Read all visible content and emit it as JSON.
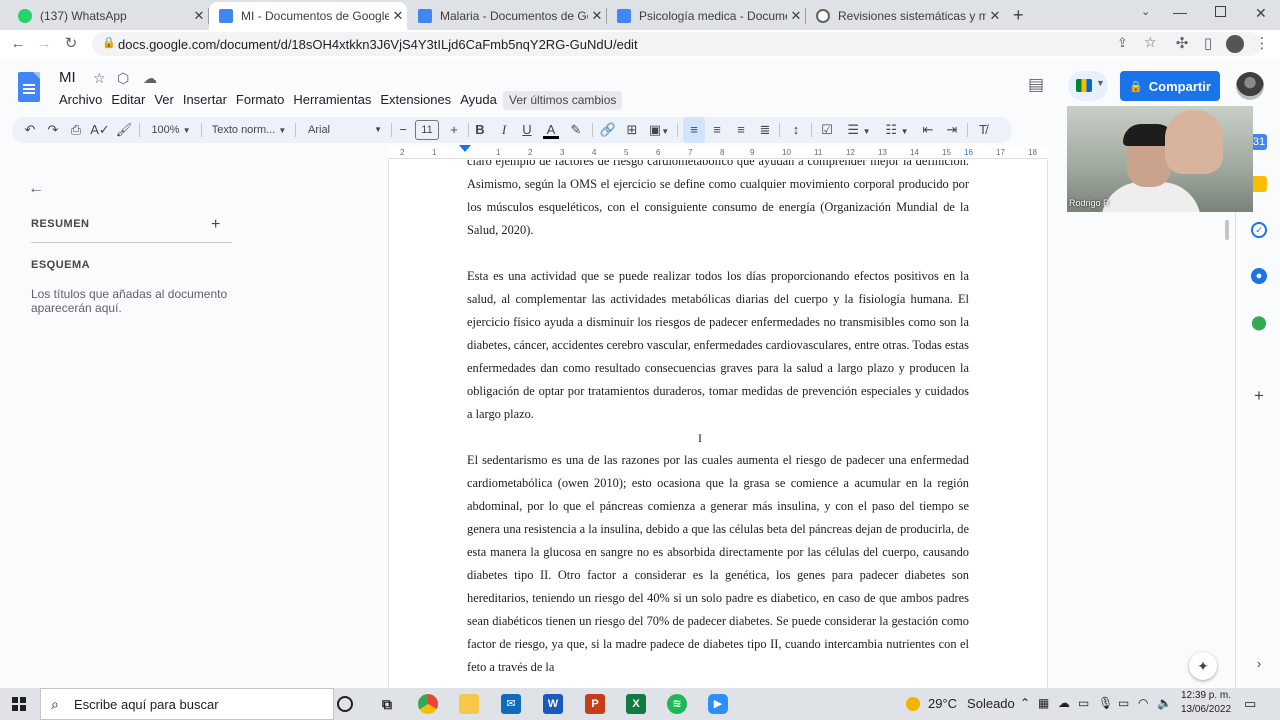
{
  "browser": {
    "tabs": [
      {
        "title": "(137) WhatsApp",
        "favicon_color": "#25d366",
        "active": false
      },
      {
        "title": "MI - Documentos de Google",
        "favicon_color": "#4285f4",
        "active": true
      },
      {
        "title": "Malaria - Documentos de Google",
        "favicon_color": "#4285f4",
        "active": false
      },
      {
        "title": "Psicología medica - Documentos de Google",
        "favicon_color": "#4285f4",
        "active": false
      },
      {
        "title": "Revisiones sistemáticas y metaanálisis",
        "favicon_color": "#5f6368",
        "active": false
      }
    ],
    "url": "docs.google.com/document/d/18sOH4xtkkn3J6VjS4Y3tILjd6CaFmb5nqY2RG-GuNdU/edit",
    "new_tab_icon": "plus-icon"
  },
  "docs": {
    "title": "MI",
    "menu": [
      "Archivo",
      "Editar",
      "Ver",
      "Insertar",
      "Formato",
      "Herramientas",
      "Extensiones",
      "Ayuda"
    ],
    "last_edit": "Ver últimos cambios",
    "share_label": "Compartir",
    "accent": "#1a73e8"
  },
  "toolbar": {
    "zoom": "100%",
    "style": "Texto norm...",
    "font": "Arial",
    "font_size": "11"
  },
  "ruler": {
    "ticks": [
      "2",
      "1",
      "1",
      "2",
      "3",
      "4",
      "5",
      "6",
      "7",
      "8",
      "9",
      "10",
      "11",
      "12",
      "13",
      "14",
      "15",
      "16",
      "17",
      "18"
    ]
  },
  "outline": {
    "summary_heading": "RESUMEN",
    "outline_heading": "ESQUEMA",
    "hint": "Los títulos que añadas al documento aparecerán aquí."
  },
  "document": {
    "paragraphs": [
      "claro ejemplo de factores de riesgo cardiometabolico que ayudan a comprender mejor la definicion. Asimismo, según la OMS el ejercicio se define como cualquier movimiento corporal producido por los músculos esqueléticos, con el consiguiente consumo de energía (Organización Mundial de la Salud, 2020).",
      "Esta es una actividad que se puede realizar todos los días proporcionando efectos positivos en la salud, al complementar las actividades metabólicas diarias del cuerpo y la fisiología humana. El ejercicio físico ayuda a disminuir los riesgos de padecer enfermedades no transmisibles como son la  diabetes, cáncer, accidentes cerebro vascular, enfermedades cardiovasculares, entre otras. Todas estas enfermedades dan como resultado consecuencias graves para la salud a largo plazo y producen la obligación de optar por tratamientos duraderos, tomar  medidas de prevención especiales y cuidados a largo plazo.",
      "El sedentarismo es una de las razones por las cuales aumenta el riesgo de padecer una enfermedad cardiometabólica (owen 2010); esto ocasiona que  la grasa se comience a acumular en la región abdominal, por lo que el páncreas comienza a generar más insulina, y con el paso del tiempo se genera una resistencia a la insulina, debido a que las células beta del páncreas dejan de producirla, de esta manera la glucosa en sangre no es absorbida directamente por las células del cuerpo, causando diabetes tipo II. Otro factor a considerar es la genética, los genes para padecer diabetes son hereditarios, teniendo un riesgo del 40% si un solo padre es diabetico, en caso de que ambos padres sean diabéticos tienen un riesgo del 70% de padecer diabetes. Se puede considerar la gestación como factor de riesgo, ya que, si la madre padece de diabetes tipo II, cuando intercambia nutrientes con el feto a través de la"
    ]
  },
  "webcam": {
    "participant": "Rodrigo R"
  },
  "taskbar": {
    "search_placeholder": "Escribe aquí para buscar",
    "temperature": "29°C",
    "condition": "Soleado",
    "time": "12:39 p. m.",
    "date": "13/06/2022",
    "apps": [
      "cortana-icon",
      "task-view-icon",
      "chrome-icon",
      "file-explorer-icon",
      "mail-icon",
      "word-icon",
      "powerpoint-icon",
      "excel-icon",
      "spotify-icon",
      "zoom-icon"
    ]
  }
}
